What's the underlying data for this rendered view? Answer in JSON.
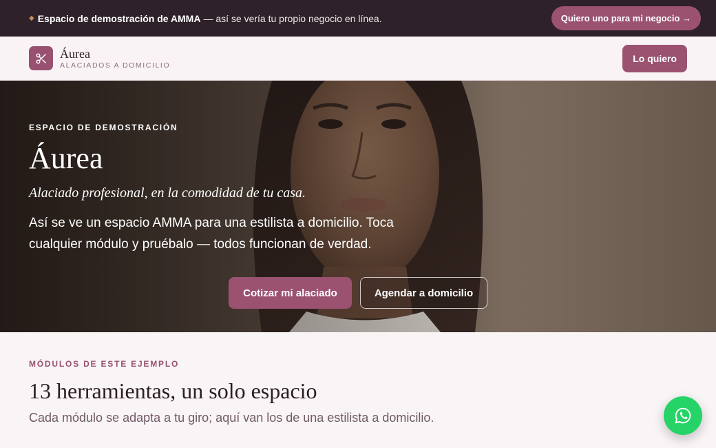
{
  "demo_bar": {
    "bold_text": "Espacio de demostración de AMMA",
    "rest_text": "— así se vería tu propio negocio en línea.",
    "cta_label": "Quiero uno para mi negocio →"
  },
  "header": {
    "brand_name": "Áurea",
    "brand_subtitle": "ALACIADOS A DOMICILIO",
    "cta_label": "Lo quiero"
  },
  "hero": {
    "eyebrow": "ESPACIO DE DEMOSTRACIÓN",
    "title": "Áurea",
    "tagline": "Alaciado profesional, en la comodidad de tu casa.",
    "description": "Así se ve un espacio AMMA para una estilista a domicilio. Toca cualquier módulo y pruébalo — todos funcionan de verdad.",
    "primary_cta": "Cotizar mi alaciado",
    "secondary_cta": "Agendar a domicilio"
  },
  "modules": {
    "eyebrow": "MÓDULOS DE ESTE EJEMPLO",
    "title": "13 herramientas, un solo espacio",
    "subtitle": "Cada módulo se adapta a tu giro; aquí van los de una estilista a domicilio."
  },
  "icons": {
    "logo": "scissors-icon",
    "fab": "whatsapp-icon",
    "banner": "diamond-icon"
  },
  "colors": {
    "accent": "#9b5270",
    "banner_bg": "#2e2129",
    "page_bg": "#f9f4f6",
    "whatsapp": "#25d366"
  }
}
